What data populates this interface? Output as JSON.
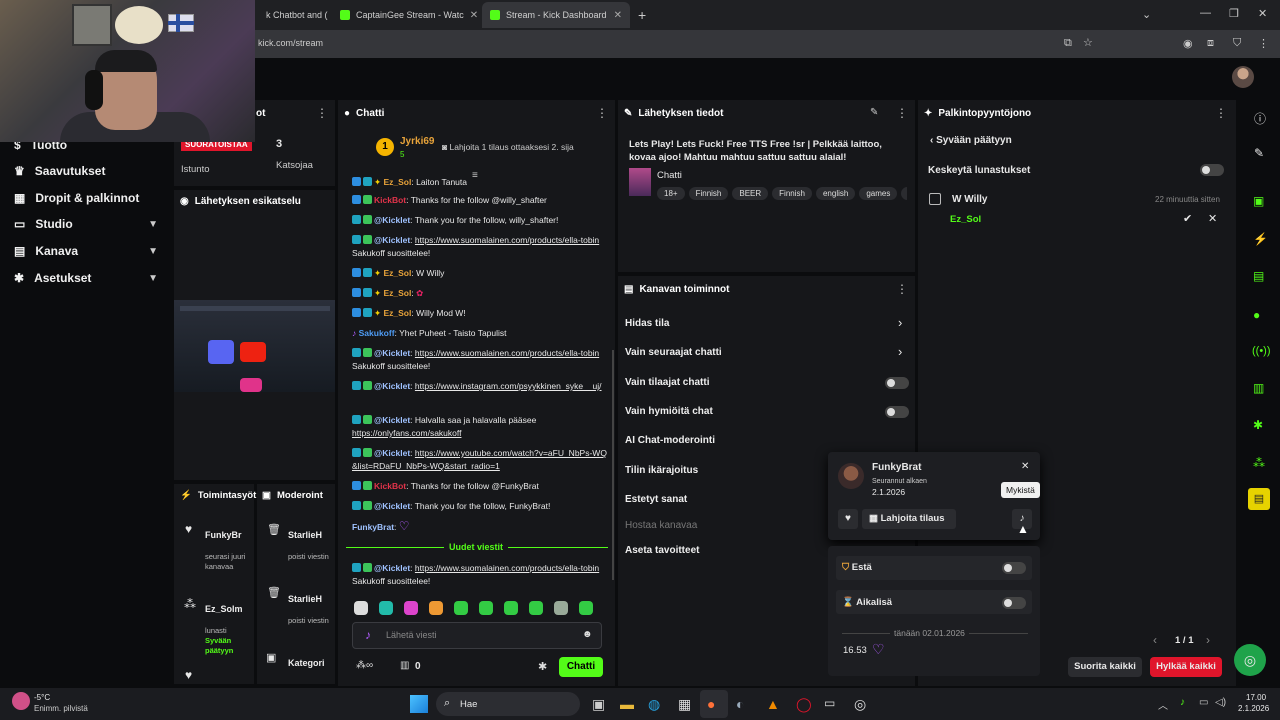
{
  "browser": {
    "tabs": [
      {
        "title": "k Chatbot and (",
        "active": false
      },
      {
        "title": "CaptainGee Stream - Watc",
        "active": false
      },
      {
        "title": "Stream - Kick Dashboard",
        "active": true
      }
    ],
    "url": "kick.com/stream"
  },
  "nav": {
    "items": [
      {
        "label": "Tuotto",
        "icon": "dollar-icon"
      },
      {
        "label": "Saavutukset",
        "icon": "trophy-icon"
      },
      {
        "label": "Dropit & palkinnot",
        "icon": "gift-icon"
      },
      {
        "label": "Studio",
        "icon": "monitor-icon"
      },
      {
        "label": "Kanava",
        "icon": "channel-icon"
      },
      {
        "label": "Asetukset",
        "icon": "gear-icon"
      }
    ]
  },
  "stats": {
    "header": "ot",
    "live_badge": "SUORATOISTAA",
    "viewers": "3",
    "session_label": "Istunto",
    "viewers_label": "Katsojaa"
  },
  "preview": {
    "title": "Lähetyksen esikatselu"
  },
  "chat": {
    "title": "Chatti",
    "pinned_user": "Jyrki69",
    "pinned_count": "5",
    "gift_prompt": "Lahjoita 1 tilaus ottaaksesi 2. sija",
    "messages": [
      {
        "user": "Ez_Sol",
        "text": "Laiton Tanuta",
        "color": "#e8a33a"
      },
      {
        "user": "KickBot",
        "text": ": Thanks for the follow @willy_shafter",
        "color": "#e0334a"
      },
      {
        "user": "@Kicklet",
        "text": ": Thank you for the follow, willy_shafter!",
        "color": "#9fc2ff"
      },
      {
        "user": "@Kicklet",
        "text": ": ",
        "link": "https://www.suomalainen.com/products/ella-tobin",
        "after": " Sakukoff suosittelee!",
        "color": "#9fc2ff"
      },
      {
        "user": "Ez_Sol",
        "text": ": W Willy",
        "color": "#e8a33a"
      },
      {
        "user": "Ez_Sol",
        "text": ": ",
        "color": "#e8a33a"
      },
      {
        "user": "Ez_Sol",
        "text": ": Willy Mod W!",
        "color": "#e8a33a"
      },
      {
        "user": "Sakukoff",
        "text": ": Yhet Puheet - Taisto Tapulist",
        "color": "#4e9cf5"
      },
      {
        "user": "@Kicklet",
        "text": ": ",
        "link": "https://www.suomalainen.com/products/ella-tobin",
        "after": " Sakukoff suosittelee!",
        "color": "#9fc2ff"
      },
      {
        "user": "@Kicklet",
        "text": ": ",
        "link": "https://www.instagram.com/psyykkinen_syke__uj/",
        "after": "",
        "color": "#9fc2ff"
      },
      {
        "user": "@Kicklet",
        "text": ": Halvalla saa ja halavalla pääsee ",
        "link": "https://onlyfans.com/sakukoff",
        "after": "",
        "color": "#9fc2ff"
      },
      {
        "user": "@Kicklet",
        "text": ": ",
        "link": "https://www.youtube.com/watch?v=aFU_NbPs-WQ&list=RDaFU_NbPs-WQ&start_radio=1",
        "after": "",
        "color": "#9fc2ff"
      },
      {
        "user": "KickBot",
        "text": ": Thanks for the follow @FunkyBrat",
        "color": "#e0334a"
      },
      {
        "user": "@Kicklet",
        "text": ": Thank you for the follow, FunkyBrat!",
        "color": "#9fc2ff"
      },
      {
        "user": "FunkyBrat",
        "text": ":",
        "color": "#9fc2ff"
      }
    ],
    "new_messages": "Uudet viestit",
    "last": {
      "user": "@Kicklet",
      "text": ": ",
      "link": "https://www.suomalainen.com/products/ella-tobin",
      "after": " Sakukoff suosittelee!"
    },
    "input_placeholder": "Lähetä viesti",
    "points": "0",
    "send": "Chatti"
  },
  "info": {
    "title": "Lähetyksen tiedot",
    "stream_title": "Lets Play! Lets Fuck! Free TTS Free !sr | Pelkkää laittoo, kovaa ajoo! Mahtuu mahtuu sattuu sattuu alaial!",
    "category": "Chatti",
    "tags": [
      "18+",
      "Finnish",
      "BEER",
      "Finnish",
      "english",
      "games",
      "ja"
    ]
  },
  "actions": {
    "title": "Kanavan toiminnot",
    "items": [
      {
        "label": "Hidas tila",
        "kind": "arrow"
      },
      {
        "label": "Vain seuraajat chatti",
        "kind": "arrow"
      },
      {
        "label": "Vain tilaajat chatti",
        "kind": "toggle"
      },
      {
        "label": "Vain hymiöitä chat",
        "kind": "toggle"
      },
      {
        "label": "AI Chat-moderointi",
        "kind": "none"
      },
      {
        "label": "Tilin ikärajoitus",
        "kind": "none"
      },
      {
        "label": "Estetyt sanat",
        "kind": "none"
      },
      {
        "label": "Hostaa kanavaa",
        "kind": "dim"
      },
      {
        "label": "Aseta tavoitteet",
        "kind": "none"
      }
    ]
  },
  "rewards": {
    "title": "Palkintopyyntöjono",
    "back": "Syvään päätyyn",
    "pause": "Keskeytä lunastukset",
    "request": {
      "name": "W Willy",
      "time": "22 minuuttia sitten",
      "user": "Ez_Sol"
    },
    "pager": "1 / 1",
    "complete_all": "Suorita kaikki",
    "reject_all": "Hylkää kaikki"
  },
  "activity": {
    "title": "Toimintasyöt",
    "items": [
      {
        "user": "FunkyBr",
        "desc": "seurasi juuri kanavaa"
      },
      {
        "user": "Ez_Solm",
        "desc": "lunasti",
        "reward": "Syvään päätyyn"
      }
    ]
  },
  "modlog": {
    "title": "Moderoint",
    "items": [
      {
        "user": "StarlieH",
        "desc": "poisti viestin"
      },
      {
        "user": "StarlieH",
        "desc": "poisti viestin"
      },
      {
        "user": "Kategori",
        "desc": ""
      }
    ]
  },
  "usercard": {
    "name": "FunkyBrat",
    "followed_label": "Seurannut alkaen",
    "followed_date": "2.1.2026",
    "gift": "Lahjoita tilaus",
    "tooltip": "Mykistä",
    "ban": "Estä",
    "timeout": "Aikalisä",
    "divider": "tänään 02.01.2026",
    "msg_time": "16.53"
  },
  "taskbar": {
    "weather_temp": "-5°C",
    "weather_desc": "Enimm. pilvistä",
    "search": "Hae",
    "time": "17.00",
    "date": "2.1.2026"
  },
  "colors": {
    "accent": "#53fc18",
    "danger": "#e0152b",
    "panel": "#16171a"
  }
}
